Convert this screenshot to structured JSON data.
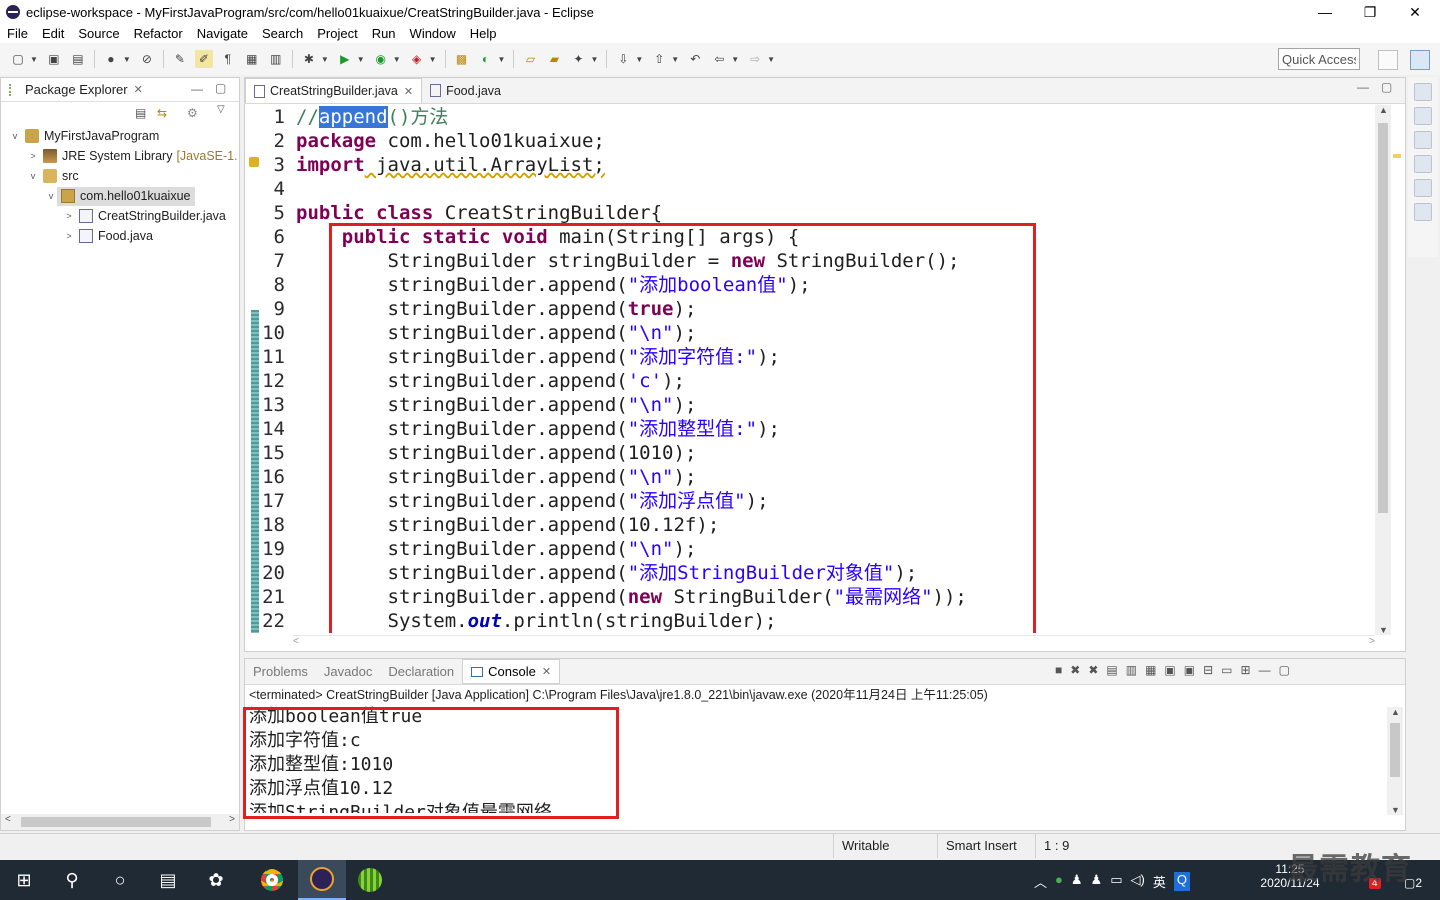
{
  "window": {
    "title": "eclipse-workspace - MyFirstJavaProgram/src/com/hello01kuaixue/CreatStringBuilder.java - Eclipse",
    "minimize": "—",
    "maximize": "❐",
    "close": "✕"
  },
  "menu": [
    "File",
    "Edit",
    "Source",
    "Refactor",
    "Navigate",
    "Search",
    "Project",
    "Run",
    "Window",
    "Help"
  ],
  "toolbar": {
    "quick_access": "Quick Access"
  },
  "package_explorer": {
    "title": "Package Explorer",
    "close": "✕",
    "tree": [
      {
        "label": "MyFirstJavaProgram",
        "icon": "project-icon",
        "toggle": "v",
        "extra": ""
      },
      {
        "label": "JRE System Library",
        "icon": "library-icon",
        "toggle": ">",
        "extra": "[JavaSE-1."
      },
      {
        "label": "src",
        "icon": "source-folder-icon",
        "toggle": "v",
        "extra": ""
      },
      {
        "label": "com.hello01kuaixue",
        "icon": "package-icon",
        "toggle": "v",
        "extra": ""
      },
      {
        "label": "CreatStringBuilder.java",
        "icon": "java-file-icon",
        "toggle": ">",
        "extra": ""
      },
      {
        "label": "Food.java",
        "icon": "java-file-icon",
        "toggle": ">",
        "extra": ""
      }
    ]
  },
  "editor": {
    "tabs": [
      {
        "label": "CreatStringBuilder.java",
        "close": "✕",
        "active": true
      },
      {
        "label": "Food.java",
        "close": "",
        "active": false
      }
    ],
    "line_numbers": [
      "1",
      "2",
      "3",
      "4",
      "5",
      "6",
      "7",
      "8",
      "9",
      "10",
      "11",
      "12",
      "13",
      "14",
      "15",
      "16",
      "17",
      "18",
      "19",
      "20",
      "21",
      "22"
    ],
    "code": {
      "l1_a": "//",
      "l1_sel": "append",
      "l1_b": "()方法",
      "l2_kw": "package",
      "l2_rest": " com.hello01kuaixue;",
      "l3_kw": "import",
      "l3_rest": " java.util.ArrayList;",
      "l5_kw": "public class",
      "l5_rest": " CreatStringBuilder{",
      "l6_kw": "public static void",
      "l6_rest": " main(String[] args) {",
      "l7_a": "StringBuilder stringBuilder = ",
      "l7_kw": "new",
      "l7_b": " StringBuilder();",
      "recv": "stringBuilder.append(",
      "l8_str": "\"添加boolean值\"",
      "l9_kw": "true",
      "nl": "\"\\n\"",
      "l11_str": "\"添加字符值:\"",
      "l12_str": "'c'",
      "l14_str": "\"添加整型值:\"",
      "l15_val": "1010",
      "l17_str": "\"添加浮点值\"",
      "l18_val": "10.12f",
      "l20_str": "\"添加StringBuilder对象值\"",
      "l21_kw": "new",
      "l21_a": " StringBuilder(",
      "l21_str": "\"最需网络\"",
      "l21_b": "));",
      "l22_a": "System.",
      "l22_fld": "out",
      "l22_b": ".println(stringBuilder);",
      "close1": ");",
      "close2": ");"
    }
  },
  "console": {
    "tabs": [
      "Problems",
      "Javadoc",
      "Declaration",
      "Console"
    ],
    "header": "<terminated> CreatStringBuilder [Java Application] C:\\Program Files\\Java\\jre1.8.0_221\\bin\\javaw.exe (2020年11月24日 上午11:25:05)",
    "output": [
      "添加boolean值true",
      "添加字符值:c",
      "添加整型值:1010",
      "添加浮点值10.12",
      "添加StringBuilder对象值最需网络"
    ]
  },
  "status": {
    "writable": "Writable",
    "insert": "Smart Insert",
    "position": "1 : 9"
  },
  "taskbar": {
    "time": "11:25",
    "date": "2020/11/24",
    "ime": "英",
    "badge1": "4",
    "badge2": "2",
    "watermark": "最需教育"
  },
  "colors": {
    "keyword": "#7f0055",
    "string": "#2a00ff",
    "comment": "#3f7f5f",
    "highlight_box": "#e02020",
    "selection": "#3875d7"
  }
}
